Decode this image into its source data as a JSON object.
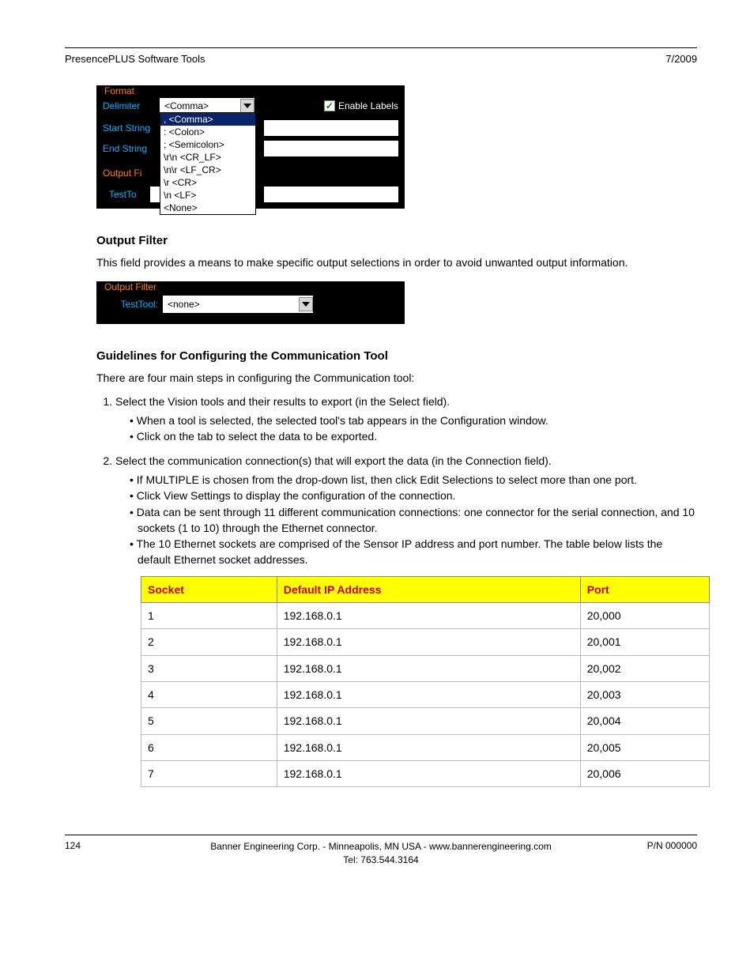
{
  "header": {
    "left": "PresencePLUS Software Tools",
    "right": "7/2009"
  },
  "format_widget": {
    "group_label": "Format",
    "delimiter_label": "Delimiter",
    "delimiter_value": "<Comma>",
    "enable_labels_text": "Enable Labels",
    "enable_labels_checked": true,
    "dropdown_options": [
      {
        "code": ",",
        "name": "<Comma>",
        "selected": true
      },
      {
        "code": ":",
        "name": "<Colon>",
        "selected": false
      },
      {
        "code": ";",
        "name": "<Semicolon>",
        "selected": false
      },
      {
        "code": "\\r\\n",
        "name": "<CR_LF>",
        "selected": false
      },
      {
        "code": "\\n\\r",
        "name": "<LF_CR>",
        "selected": false
      },
      {
        "code": "\\r",
        "name": "<CR>",
        "selected": false
      },
      {
        "code": "\\n",
        "name": "<LF>",
        "selected": false
      },
      {
        "code": "",
        "name": "<None>",
        "selected": false
      }
    ],
    "start_string_label": "Start String",
    "end_string_label": "End String",
    "output_filter_label": "Output Fi",
    "testtool_label": "TestTo"
  },
  "sec_output_filter": {
    "heading": "Output Filter",
    "body": "This field provides a means to make specific output selections in order to avoid unwanted output information."
  },
  "of_widget": {
    "group_label": "Output Filter",
    "testtool_label": "TestTool:",
    "testtool_value": "<none>"
  },
  "sec_guidelines": {
    "heading": "Guidelines for Configuring the Communication Tool",
    "intro": "There are four main steps in configuring the Communication tool:",
    "step1": "Select the Vision tools and their results to export (in the Select field).",
    "step1_bullets": [
      "When a tool is selected, the selected tool's tab appears in the Configuration window.",
      "Click on the tab to select the data to be exported."
    ],
    "step2": "Select the communication connection(s) that will export the data (in the Connection field).",
    "step2_bullets": [
      "If MULTIPLE is chosen from the drop-down list, then click Edit Selections to select more than one port.",
      "Click View Settings to display the configuration of the connection.",
      "Data can be sent through 11 different communication connections: one connector for the serial connection, and 10 sockets (1 to 10) through the Ethernet connector.",
      "The 10 Ethernet sockets are comprised of the Sensor IP address and port number. The table below lists the default Ethernet socket addresses."
    ]
  },
  "socket_table": {
    "headers": [
      "Socket",
      "Default IP Address",
      "Port"
    ],
    "rows": [
      [
        "1",
        "192.168.0.1",
        "20,000"
      ],
      [
        "2",
        "192.168.0.1",
        "20,001"
      ],
      [
        "3",
        "192.168.0.1",
        "20,002"
      ],
      [
        "4",
        "192.168.0.1",
        "20,003"
      ],
      [
        "5",
        "192.168.0.1",
        "20,004"
      ],
      [
        "6",
        "192.168.0.1",
        "20,005"
      ],
      [
        "7",
        "192.168.0.1",
        "20,006"
      ]
    ]
  },
  "footer": {
    "page_no": "124",
    "mid1": "Banner Engineering Corp. - Minneapolis, MN USA - www.bannerengineering.com",
    "mid2": "Tel: 763.544.3164",
    "right": "P/N 000000"
  }
}
